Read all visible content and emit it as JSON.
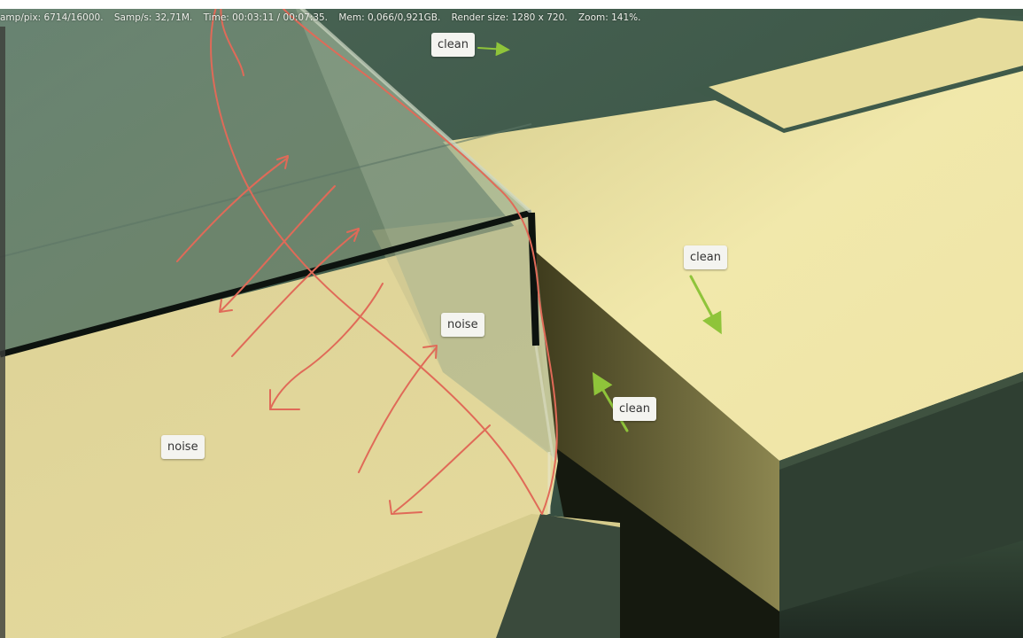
{
  "status": {
    "samples": "amp/pix: 6714/16000.",
    "samp_rate": "Samp/s: 32,71M.",
    "time": "Time: 00:03:11 / 00:07:35.",
    "mem": "Mem: 0,066/0,921GB.",
    "render_size": "Render size: 1280 x 720.",
    "zoom": "Zoom: 141%."
  },
  "annotations": [
    {
      "text": "clean"
    },
    {
      "text": "clean"
    },
    {
      "text": "clean"
    },
    {
      "text": "noise"
    },
    {
      "text": "noise"
    }
  ],
  "colors": {
    "scribble": "#e06a58",
    "arrow_green": "#8fc43a",
    "wood_light": "#f2e9ad",
    "wood_mid": "#d9cf8e",
    "background_green": "#3f5a4a",
    "glass_edge": "#0d130f"
  }
}
